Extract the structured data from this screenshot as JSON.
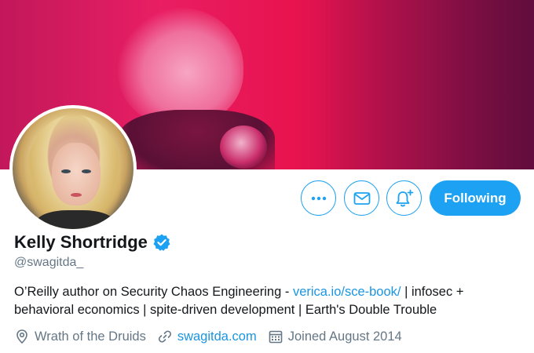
{
  "profile": {
    "name": "Kelly Shortridge",
    "handle": "@swagitda_",
    "bio_text_1": "O’Reilly author on Security Chaos Engineering - ",
    "bio_link": "verica.io/sce-book/",
    "bio_text_2": " | infosec + behavioral economics | spite-driven development | Earth's Double Trouble",
    "location": "Wrath of the Druids",
    "website": "swagitda.com",
    "joined": "Joined August 2014"
  },
  "actions": {
    "following_label": "Following"
  },
  "icons": {
    "more": "more-icon",
    "message": "mail-icon",
    "notify": "bell-plus-icon",
    "verified": "verified-badge-icon",
    "location": "location-pin-icon",
    "link": "link-icon",
    "calendar": "calendar-icon"
  },
  "colors": {
    "accent": "#1da1f2",
    "link": "#1b95e0",
    "secondary_text": "#657786",
    "banner_tint": "#e8134f"
  }
}
